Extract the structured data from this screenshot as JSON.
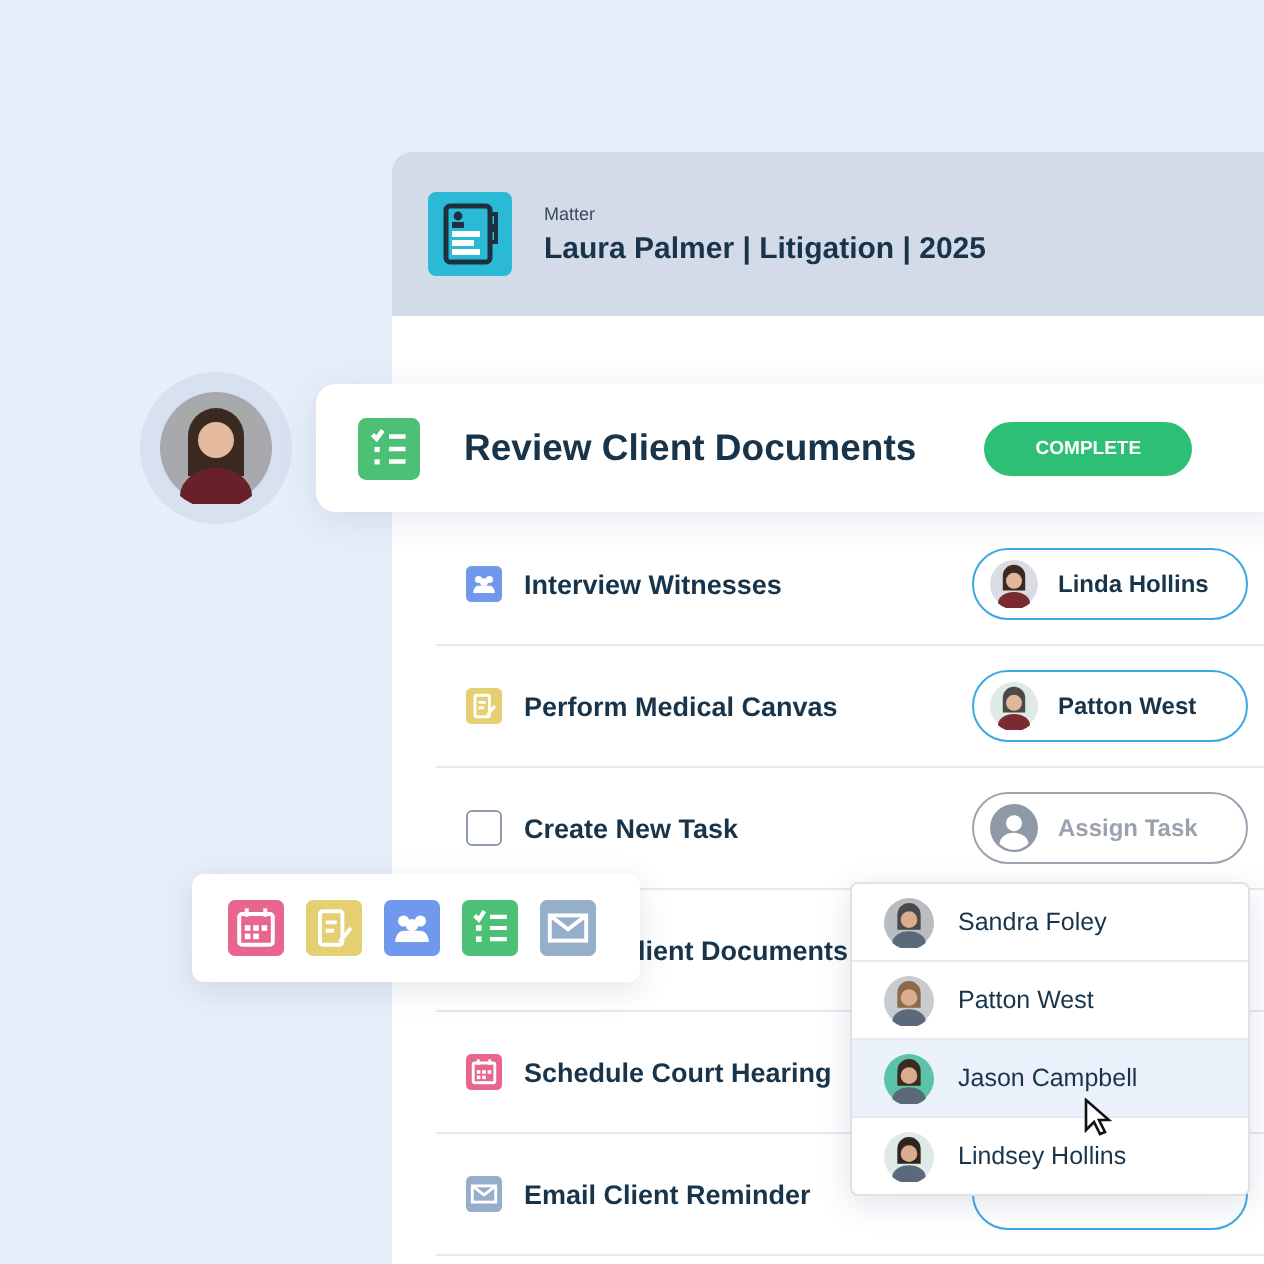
{
  "matter": {
    "label": "Matter",
    "title": "Laura Palmer | Litigation | 2025"
  },
  "focus_task": {
    "kind": "checklist",
    "title": "Review Client Documents",
    "action": "COMPLETE"
  },
  "tasks": [
    {
      "kind": "people",
      "title": "Interview Witnesses",
      "assignee": "Linda Hollins"
    },
    {
      "kind": "notes",
      "title": "Perform Medical Canvas",
      "assignee": "Patton West"
    },
    {
      "kind": "checkbox",
      "title": "Create New Task",
      "checked": false,
      "placeholder": "Assign Task"
    },
    {
      "kind": "covered",
      "title": "lient Documents"
    },
    {
      "kind": "calendar",
      "title": "Schedule Court Hearing"
    },
    {
      "kind": "mail",
      "title": "Email Client Reminder",
      "assigned": true
    }
  ],
  "type_palette": [
    {
      "kind": "calendar"
    },
    {
      "kind": "notes"
    },
    {
      "kind": "people"
    },
    {
      "kind": "checklist"
    },
    {
      "kind": "mail"
    }
  ],
  "assignee_menu": [
    {
      "name": "Sandra Foley",
      "selected": false
    },
    {
      "name": "Patton West",
      "selected": false
    },
    {
      "name": "Jason Campbell",
      "selected": true
    },
    {
      "name": "Lindsey Hollins",
      "selected": false
    }
  ]
}
